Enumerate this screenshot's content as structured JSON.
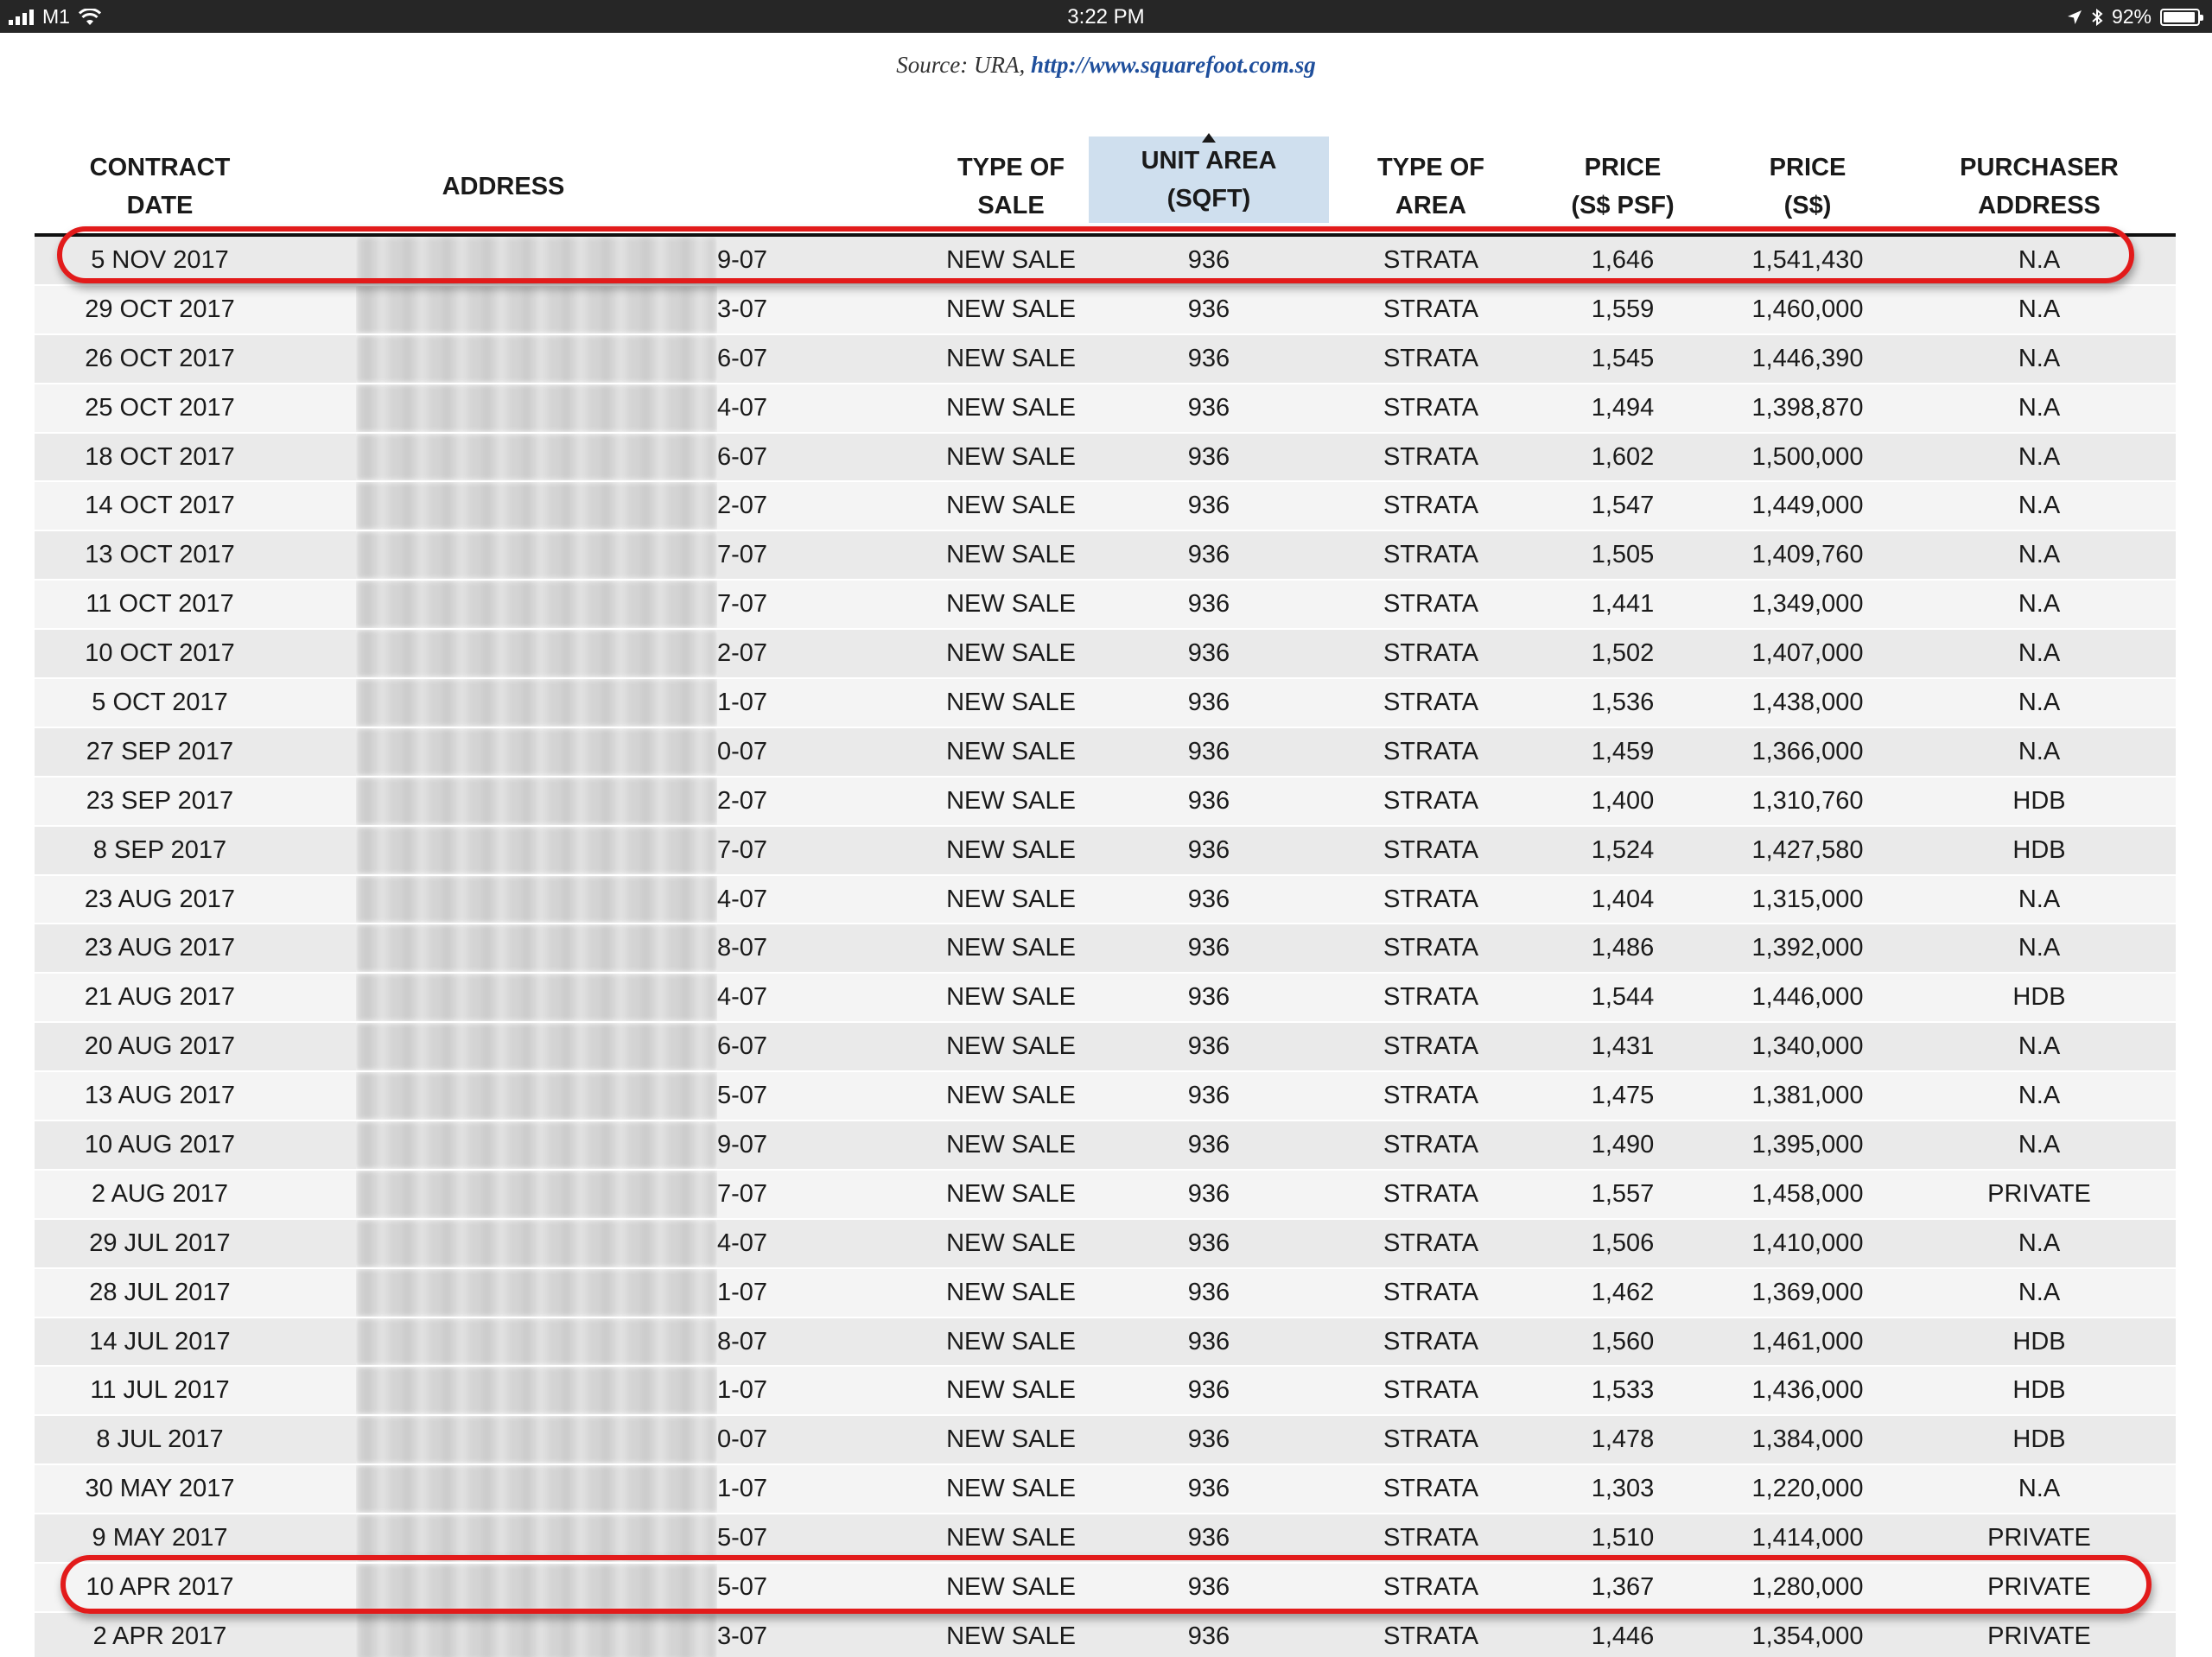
{
  "status_bar": {
    "carrier": "M1",
    "time": "3:22 PM",
    "battery": "92%"
  },
  "source": {
    "prefix": "Source: URA, ",
    "link": "http://www.squarefoot.com.sg"
  },
  "table": {
    "headers": {
      "date_l1": "CONTRACT",
      "date_l2": "DATE",
      "address": "ADDRESS",
      "sale_l1": "TYPE OF",
      "sale_l2": "SALE",
      "area_l1": "UNIT AREA",
      "area_l2": "(SQFT)",
      "atype_l1": "TYPE OF",
      "atype_l2": "AREA",
      "psf_l1": "PRICE",
      "psf_l2": "(S$ PSF)",
      "price_l1": "PRICE",
      "price_l2": "(S$)",
      "purch_l1": "PURCHASER",
      "purch_l2": "ADDRESS"
    },
    "sorted_column": "UNIT AREA (SQFT)",
    "rows": [
      {
        "date": "5 NOV 2017",
        "unit": "9-07",
        "sale": "NEW SALE",
        "area": "936",
        "atype": "STRATA",
        "psf": "1,646",
        "price": "1,541,430",
        "purchaser": "N.A"
      },
      {
        "date": "29 OCT 2017",
        "unit": "3-07",
        "sale": "NEW SALE",
        "area": "936",
        "atype": "STRATA",
        "psf": "1,559",
        "price": "1,460,000",
        "purchaser": "N.A"
      },
      {
        "date": "26 OCT 2017",
        "unit": "6-07",
        "sale": "NEW SALE",
        "area": "936",
        "atype": "STRATA",
        "psf": "1,545",
        "price": "1,446,390",
        "purchaser": "N.A"
      },
      {
        "date": "25 OCT 2017",
        "unit": "4-07",
        "sale": "NEW SALE",
        "area": "936",
        "atype": "STRATA",
        "psf": "1,494",
        "price": "1,398,870",
        "purchaser": "N.A"
      },
      {
        "date": "18 OCT 2017",
        "unit": "6-07",
        "sale": "NEW SALE",
        "area": "936",
        "atype": "STRATA",
        "psf": "1,602",
        "price": "1,500,000",
        "purchaser": "N.A"
      },
      {
        "date": "14 OCT 2017",
        "unit": "2-07",
        "sale": "NEW SALE",
        "area": "936",
        "atype": "STRATA",
        "psf": "1,547",
        "price": "1,449,000",
        "purchaser": "N.A"
      },
      {
        "date": "13 OCT 2017",
        "unit": "7-07",
        "sale": "NEW SALE",
        "area": "936",
        "atype": "STRATA",
        "psf": "1,505",
        "price": "1,409,760",
        "purchaser": "N.A"
      },
      {
        "date": "11 OCT 2017",
        "unit": "7-07",
        "sale": "NEW SALE",
        "area": "936",
        "atype": "STRATA",
        "psf": "1,441",
        "price": "1,349,000",
        "purchaser": "N.A"
      },
      {
        "date": "10 OCT 2017",
        "unit": "2-07",
        "sale": "NEW SALE",
        "area": "936",
        "atype": "STRATA",
        "psf": "1,502",
        "price": "1,407,000",
        "purchaser": "N.A"
      },
      {
        "date": "5 OCT 2017",
        "unit": "1-07",
        "sale": "NEW SALE",
        "area": "936",
        "atype": "STRATA",
        "psf": "1,536",
        "price": "1,438,000",
        "purchaser": "N.A"
      },
      {
        "date": "27 SEP 2017",
        "unit": "0-07",
        "sale": "NEW SALE",
        "area": "936",
        "atype": "STRATA",
        "psf": "1,459",
        "price": "1,366,000",
        "purchaser": "N.A"
      },
      {
        "date": "23 SEP 2017",
        "unit": "2-07",
        "sale": "NEW SALE",
        "area": "936",
        "atype": "STRATA",
        "psf": "1,400",
        "price": "1,310,760",
        "purchaser": "HDB"
      },
      {
        "date": "8 SEP 2017",
        "unit": "7-07",
        "sale": "NEW SALE",
        "area": "936",
        "atype": "STRATA",
        "psf": "1,524",
        "price": "1,427,580",
        "purchaser": "HDB"
      },
      {
        "date": "23 AUG 2017",
        "unit": "4-07",
        "sale": "NEW SALE",
        "area": "936",
        "atype": "STRATA",
        "psf": "1,404",
        "price": "1,315,000",
        "purchaser": "N.A"
      },
      {
        "date": "23 AUG 2017",
        "unit": "8-07",
        "sale": "NEW SALE",
        "area": "936",
        "atype": "STRATA",
        "psf": "1,486",
        "price": "1,392,000",
        "purchaser": "N.A"
      },
      {
        "date": "21 AUG 2017",
        "unit": "4-07",
        "sale": "NEW SALE",
        "area": "936",
        "atype": "STRATA",
        "psf": "1,544",
        "price": "1,446,000",
        "purchaser": "HDB"
      },
      {
        "date": "20 AUG 2017",
        "unit": "6-07",
        "sale": "NEW SALE",
        "area": "936",
        "atype": "STRATA",
        "psf": "1,431",
        "price": "1,340,000",
        "purchaser": "N.A"
      },
      {
        "date": "13 AUG 2017",
        "unit": "5-07",
        "sale": "NEW SALE",
        "area": "936",
        "atype": "STRATA",
        "psf": "1,475",
        "price": "1,381,000",
        "purchaser": "N.A"
      },
      {
        "date": "10 AUG 2017",
        "unit": "9-07",
        "sale": "NEW SALE",
        "area": "936",
        "atype": "STRATA",
        "psf": "1,490",
        "price": "1,395,000",
        "purchaser": "N.A"
      },
      {
        "date": "2 AUG 2017",
        "unit": "7-07",
        "sale": "NEW SALE",
        "area": "936",
        "atype": "STRATA",
        "psf": "1,557",
        "price": "1,458,000",
        "purchaser": "PRIVATE"
      },
      {
        "date": "29 JUL 2017",
        "unit": "4-07",
        "sale": "NEW SALE",
        "area": "936",
        "atype": "STRATA",
        "psf": "1,506",
        "price": "1,410,000",
        "purchaser": "N.A"
      },
      {
        "date": "28 JUL 2017",
        "unit": "1-07",
        "sale": "NEW SALE",
        "area": "936",
        "atype": "STRATA",
        "psf": "1,462",
        "price": "1,369,000",
        "purchaser": "N.A"
      },
      {
        "date": "14 JUL 2017",
        "unit": "8-07",
        "sale": "NEW SALE",
        "area": "936",
        "atype": "STRATA",
        "psf": "1,560",
        "price": "1,461,000",
        "purchaser": "HDB"
      },
      {
        "date": "11 JUL 2017",
        "unit": "1-07",
        "sale": "NEW SALE",
        "area": "936",
        "atype": "STRATA",
        "psf": "1,533",
        "price": "1,436,000",
        "purchaser": "HDB"
      },
      {
        "date": "8 JUL 2017",
        "unit": "0-07",
        "sale": "NEW SALE",
        "area": "936",
        "atype": "STRATA",
        "psf": "1,478",
        "price": "1,384,000",
        "purchaser": "HDB"
      },
      {
        "date": "30 MAY 2017",
        "unit": "1-07",
        "sale": "NEW SALE",
        "area": "936",
        "atype": "STRATA",
        "psf": "1,303",
        "price": "1,220,000",
        "purchaser": "N.A"
      },
      {
        "date": "9 MAY 2017",
        "unit": "5-07",
        "sale": "NEW SALE",
        "area": "936",
        "atype": "STRATA",
        "psf": "1,510",
        "price": "1,414,000",
        "purchaser": "PRIVATE"
      },
      {
        "date": "10 APR 2017",
        "unit": "5-07",
        "sale": "NEW SALE",
        "area": "936",
        "atype": "STRATA",
        "psf": "1,367",
        "price": "1,280,000",
        "purchaser": "PRIVATE"
      },
      {
        "date": "2 APR 2017",
        "unit": "3-07",
        "sale": "NEW SALE",
        "area": "936",
        "atype": "STRATA",
        "psf": "1,446",
        "price": "1,354,000",
        "purchaser": "PRIVATE"
      }
    ]
  },
  "highlighted_rows": [
    "5 NOV 2017",
    "10 APR 2017"
  ],
  "colors": {
    "highlight_oval": "#e21b1b",
    "sorted_header_bg": "#cfdfee",
    "link": "#1f4f9c"
  },
  "icons": [
    "signal-icon",
    "wifi-icon",
    "location-icon",
    "bluetooth-icon",
    "battery-icon",
    "sort-ascending-icon"
  ]
}
